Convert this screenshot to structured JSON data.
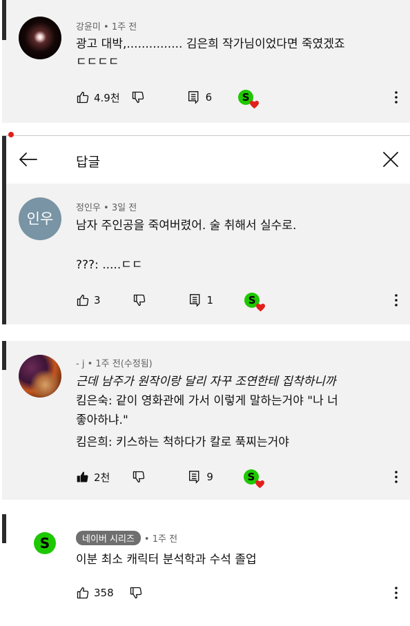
{
  "comments": [
    {
      "author": "강윤미",
      "time": "• 1주 전",
      "line1": "광고 대박,............... 김은희 작가님이었다면 죽였겠죠",
      "line2": "ㄷㄷㄷㄷ",
      "likes": "4.9천",
      "replies": "6"
    },
    {
      "author": "- j",
      "time": "• 1주 전(수정됨)",
      "line1": "근데 남주가 원작이랑 달리 자꾸 조연한테 집착하니까",
      "line2": "킴은숙: 같이 영화관에 가서 이렇게 말하는거야 \"나 너",
      "line3": "좋아하냐.\"",
      "line4": "킴은희: 키스하는 척하다가 칼로 푹찌는거야",
      "likes": "2천",
      "replies": "9"
    },
    {
      "author_badge": "네이버 시리즈",
      "time": "• 1주 전",
      "line1": "이분 최소 캐릭터 분석학과 수석 졸업",
      "likes": "358"
    }
  ],
  "reply_panel": {
    "title": "답글",
    "reply": {
      "avatar_text": "인우",
      "author": "정인우",
      "time": "• 3일 전",
      "line1": "남자 주인공을 죽여버렸어. 술 취해서 실수로.",
      "line2": "???: .....ㄷㄷ",
      "likes": "3",
      "replies": "1"
    }
  },
  "creator_badge_letter": "S",
  "colors": {
    "card_bg": "#f2f2f2",
    "accent_red": "#e0211b",
    "naver_green": "#1ec800",
    "avatar_blue": "#7994a4",
    "badge_gray": "#6f6f6f"
  },
  "icons": [
    "like-icon",
    "like-filled-icon",
    "dislike-icon",
    "reply-icon",
    "creator-heart-icon",
    "more-icon",
    "back-arrow-icon",
    "close-icon"
  ]
}
